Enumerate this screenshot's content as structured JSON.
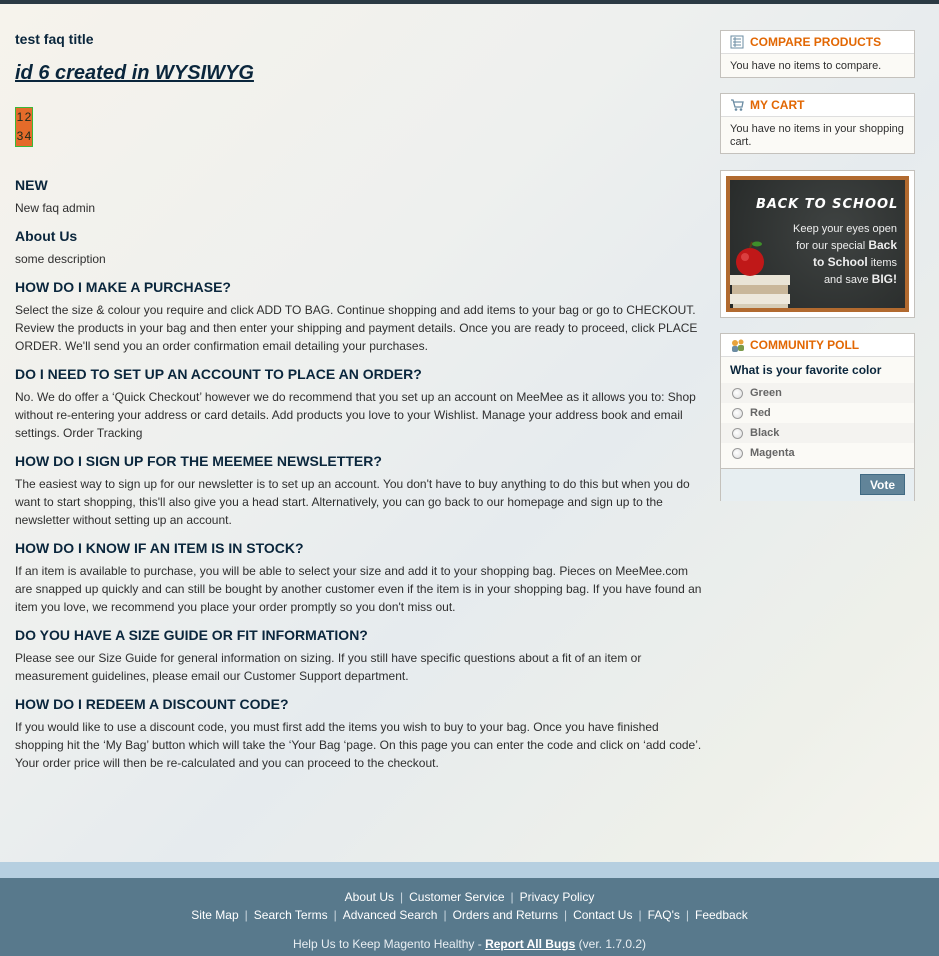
{
  "page": {
    "faq_title": "test faq title",
    "wysiwyg_heading": "id 6 created in WYSIWYG ",
    "grid": [
      [
        "1",
        "2"
      ],
      [
        "3",
        "4"
      ]
    ],
    "colors": {
      "accent": "#e26703",
      "heading": "#0a263c",
      "footer": "#58798c",
      "button": "#618499"
    }
  },
  "sections": [
    {
      "heading": "NEW",
      "text": "New faq admin"
    },
    {
      "heading": "About Us",
      "text": "some description"
    },
    {
      "heading": "HOW DO I MAKE A PURCHASE?",
      "text": "Select the size & colour you require and click ADD TO BAG. Continue shopping and add items to your bag or go to CHECKOUT. Review the products in your bag and then enter your shipping and payment details. Once you are ready to proceed, click PLACE ORDER. We'll send you an order confirmation email detailing your purchases."
    },
    {
      "heading": "DO I NEED TO SET UP AN ACCOUNT TO PLACE AN ORDER?",
      "text": "No. We do offer a ‘Quick Checkout’ however we do recommend that you set up an account on MeeMee as it allows you to: Shop without re-entering your address or card details. Add products you love to your Wishlist. Manage your address book and email settings. Order Tracking"
    },
    {
      "heading": "HOW DO I SIGN UP FOR THE MEEMEE NEWSLETTER?",
      "text": "The easiest way to sign up for our newsletter is to set up an account. You don't have to buy anything to do this but when you do want to start shopping, this'll also give you a head start. Alternatively, you can go back to our homepage and sign up to the newsletter without setting up an account."
    },
    {
      "heading": "HOW DO I KNOW IF AN ITEM IS IN STOCK?",
      "text": "If an item is available to purchase, you will be able to select your size and add it to your shopping bag. Pieces on MeeMee.com are snapped up quickly and can still be bought by another customer even if the item is in your shopping bag. If you have found an item you love, we recommend you place your order promptly so you don't miss out."
    },
    {
      "heading": "DO YOU HAVE A SIZE GUIDE OR FIT INFORMATION?",
      "text": "Please see our Size Guide for general information on sizing. If you still have specific questions about a fit of an item or measurement guidelines, please email our Customer Support department."
    },
    {
      "heading": "HOW DO I REDEEM A DISCOUNT CODE?",
      "text": "If you would like to use a discount code, you must first add the items you wish to buy to your bag. Once you have finished shopping hit the ‘My Bag’ button which will take the ‘Your Bag ‘page. On this page you can enter the code and click on ‘add code’. Your order price will then be re-calculated and you can proceed to the checkout."
    }
  ],
  "sidebar": {
    "compare": {
      "title": "COMPARE PRODUCTS",
      "icon": "compare-icon",
      "text": "You have no items to compare."
    },
    "cart": {
      "title": "MY CART",
      "icon": "cart-icon",
      "text": "You have no items in your shopping cart."
    },
    "banner": {
      "heading": "BACK TO SCHOOL",
      "line1": "Keep your eyes open",
      "line2": "for our special",
      "line2b": "Back",
      "line3": "to School",
      "line3b": "items",
      "line4": "and save",
      "line4b": "BIG!"
    },
    "poll": {
      "title": "COMMUNITY POLL",
      "icon": "poll-icon",
      "question": "What is your favorite color",
      "options": [
        "Green",
        "Red",
        "Black",
        "Magenta"
      ],
      "vote_label": "Vote"
    }
  },
  "footer": {
    "row1": [
      "About Us",
      "Customer Service",
      "Privacy Policy"
    ],
    "row2": [
      "Site Map",
      "Search Terms",
      "Advanced Search",
      "Orders and Returns",
      "Contact Us",
      "FAQ's",
      "Feedback"
    ],
    "help_prefix": "Help Us to Keep Magento Healthy - ",
    "help_link": "Report All Bugs",
    "help_suffix": " (ver. 1.7.0.2)"
  }
}
